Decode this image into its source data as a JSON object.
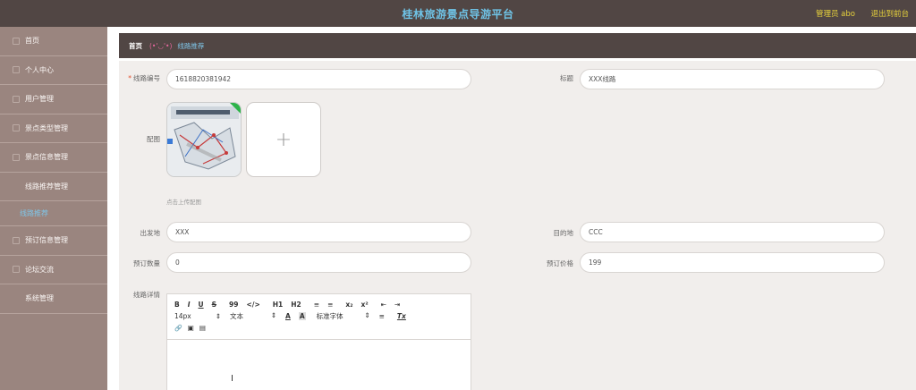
{
  "header": {
    "title": "桂林旅游景点导游平台",
    "admin_label": "管理员 abo",
    "logout_label": "退出到前台"
  },
  "sidebar": {
    "items": [
      {
        "label": "首页"
      },
      {
        "label": "个人中心"
      },
      {
        "label": "用户管理"
      },
      {
        "label": "景点类型管理"
      },
      {
        "label": "景点信息管理"
      },
      {
        "label": "线路推荐管理"
      },
      {
        "label": "预订信息管理"
      },
      {
        "label": "论坛交流"
      },
      {
        "label": "系统管理"
      }
    ],
    "sub_item": "线路推荐"
  },
  "breadcrumb": {
    "home": "首页",
    "emoticon": "(•'◡'•)",
    "current": "线路推荐"
  },
  "form": {
    "route_no_label": "线路编号",
    "route_no_value": "1618820381942",
    "title_label": "标题",
    "title_value": "XXX线路",
    "image_label": "配图",
    "upload_plus": "+",
    "upload_hint": "点击上传配图",
    "departure_label": "出发地",
    "departure_value": "XXX",
    "destination_label": "目的地",
    "destination_value": "CCC",
    "booking_count_label": "预订数量",
    "booking_count_value": "0",
    "price_label": "预订价格",
    "price_value": "199",
    "details_label": "线路详情"
  },
  "editor": {
    "row1": [
      "B",
      "I",
      "U",
      "S",
      "99",
      "</>",
      "H1",
      "H2",
      "≡",
      "≡",
      "x₂",
      "x²",
      "⇤",
      "⇥"
    ],
    "font_size": "14px",
    "text_style": "文本",
    "text_color": "A",
    "bg_color": "A",
    "font_family": "标准字体",
    "align": "≡",
    "clear": "Tx",
    "row3": [
      "🔗",
      "▣",
      "▤"
    ],
    "cursor": "I"
  },
  "colors": {
    "topbar": "#514644",
    "sidebar": "#9a857f",
    "title": "#6fc3e6",
    "accent": "#e7d23c"
  }
}
